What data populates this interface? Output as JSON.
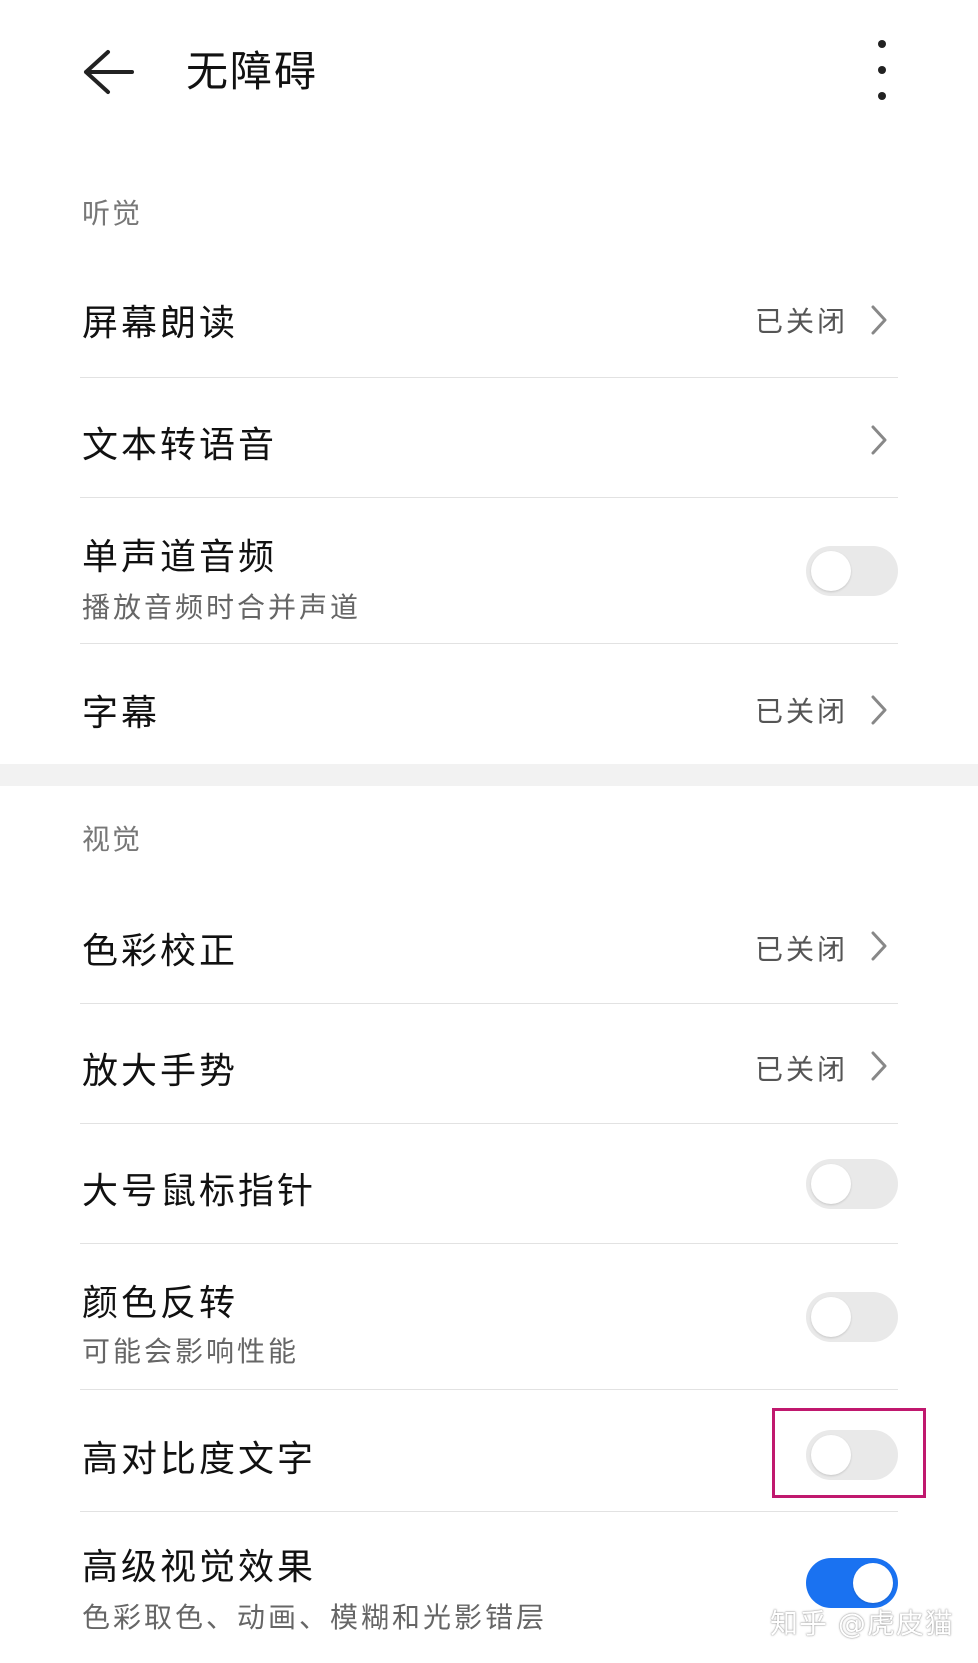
{
  "header": {
    "back_icon": "arrow-left-icon",
    "title": "无障碍",
    "more_icon": "more-vertical-icon"
  },
  "sections": {
    "hearing": {
      "title": "听觉",
      "rows": {
        "screen_reader": {
          "title": "屏幕朗读",
          "value": "已关闭"
        },
        "tts": {
          "title": "文本转语音"
        },
        "mono_audio": {
          "title": "单声道音频",
          "subtitle": "播放音频时合并声道",
          "toggle": false
        },
        "captions": {
          "title": "字幕",
          "value": "已关闭"
        }
      }
    },
    "vision": {
      "title": "视觉",
      "rows": {
        "color_correction": {
          "title": "色彩校正",
          "value": "已关闭"
        },
        "magnification": {
          "title": "放大手势",
          "value": "已关闭"
        },
        "large_pointer": {
          "title": "大号鼠标指针",
          "toggle": false
        },
        "color_inversion": {
          "title": "颜色反转",
          "subtitle": "可能会影响性能",
          "toggle": false
        },
        "high_contrast_text": {
          "title": "高对比度文字",
          "toggle": false
        },
        "advanced_visual": {
          "title": "高级视觉效果",
          "subtitle": "色彩取色、动画、模糊和光影错层",
          "toggle": true
        }
      }
    }
  },
  "watermark": "知乎 @虎皮猫",
  "colors": {
    "toggle_on": "#1a72f1",
    "toggle_off": "#e9e9e9",
    "highlight_box": "#c0186e"
  }
}
